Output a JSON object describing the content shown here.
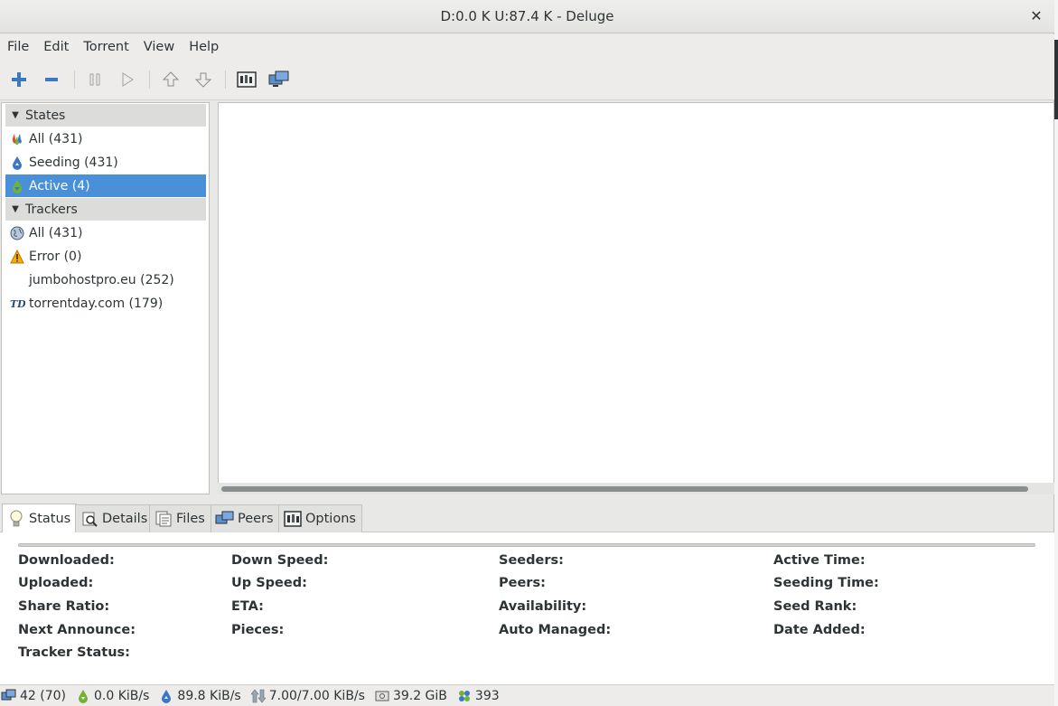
{
  "window": {
    "title": "D:0.0 K U:87.4 K - Deluge",
    "close_glyph": "✕"
  },
  "menubar": [
    "File",
    "Edit",
    "Torrent",
    "View",
    "Help"
  ],
  "toolbar": {
    "icons": [
      "add-torrent-icon",
      "remove-torrent-icon",
      "pause-icon",
      "resume-icon",
      "queue-up-icon",
      "queue-down-icon",
      "preferences-icon",
      "connection-manager-icon"
    ]
  },
  "sidebar": {
    "states_header": "States",
    "states": [
      {
        "label": "All (431)",
        "icon": "all-states-icon",
        "selected": false
      },
      {
        "label": "Seeding (431)",
        "icon": "seeding-icon",
        "selected": false
      },
      {
        "label": "Active (4)",
        "icon": "active-icon",
        "selected": true
      }
    ],
    "trackers_header": "Trackers",
    "trackers": [
      {
        "label": "All (431)",
        "icon": "globe-icon"
      },
      {
        "label": "Error (0)",
        "icon": "warning-icon"
      },
      {
        "label": "jumbohostpro.eu (252)",
        "icon": ""
      },
      {
        "label": "torrentday.com (179)",
        "icon": "torrentday-icon"
      }
    ]
  },
  "tabs": [
    {
      "label": "Status",
      "icon": "lightbulb-icon",
      "active": true
    },
    {
      "label": "Details",
      "icon": "details-icon",
      "active": false
    },
    {
      "label": "Files",
      "icon": "files-icon",
      "active": false
    },
    {
      "label": "Peers",
      "icon": "peers-icon",
      "active": false
    },
    {
      "label": "Options",
      "icon": "options-icon",
      "active": false
    }
  ],
  "status": {
    "col1": [
      "Downloaded:",
      "Uploaded:",
      "Share Ratio:",
      "Next Announce:",
      "Tracker Status:"
    ],
    "col2": [
      "Down Speed:",
      "Up Speed:",
      "ETA:",
      "Pieces:"
    ],
    "col3": [
      "Seeders:",
      "Peers:",
      "Availability:",
      "Auto Managed:"
    ],
    "col4": [
      "Active Time:",
      "Seeding Time:",
      "Seed Rank:",
      "Date Added:"
    ]
  },
  "statusbar": {
    "connections": "42 (70)",
    "down_speed": "0.0 KiB/s",
    "up_speed": "89.8 KiB/s",
    "protocol": "7.00/7.00 KiB/s",
    "free_space": "39.2 GiB",
    "dht_nodes": "393"
  },
  "colors": {
    "selection": "#4a90d9",
    "header_bg": "#dcdcda"
  }
}
